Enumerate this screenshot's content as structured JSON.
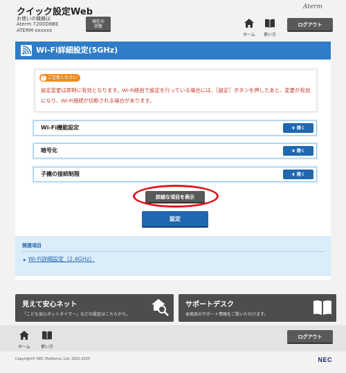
{
  "header": {
    "app_title": "クイック設定Web",
    "model_label": "お使いの機器は",
    "model_name": "Aterm 7200D8BE",
    "model_id": "ATERM-xxxxxx",
    "status_button": "現在の\n状態",
    "brand": "Aterm",
    "home_label": "ホーム",
    "manual_label": "使い方",
    "logout_label": "ログアウト"
  },
  "panel": {
    "title": "Wi-Fi詳細設定(5GHz)",
    "notice_badge": "ご注意ください",
    "notice_text": "設定変更は即時に有効となります。Wi-Fi経由で設定を行っている場合には、［設定］ボタンを押したあと、変更が有効になり、Wi-Fi接続が切断される場合があります。",
    "sections": [
      {
        "label": "Wi-Fi機能設定",
        "button": "開く"
      },
      {
        "label": "暗号化",
        "button": "開く"
      },
      {
        "label": "子機の接続制限",
        "button": "開く"
      }
    ],
    "detail_button": "詳細な項目を表示",
    "save_button": "設定"
  },
  "related": {
    "title": "関連項目",
    "link": "Wi-Fi詳細設定（2.4GHz）"
  },
  "banners": [
    {
      "title": "見えて安心ネット",
      "subtitle": "「こども安心ネットタイマー」などの設定はこちらから。"
    },
    {
      "title": "サポートデスク",
      "subtitle": "本商品のサポート情報をご覧いただけます。"
    }
  ],
  "footer": {
    "home_label": "ホーム",
    "manual_label": "使い方",
    "logout_label": "ログアウト",
    "copyright": "Copyright© NEC Platforms, Ltd. 2001-2025",
    "brand": "NEC"
  },
  "colors": {
    "accent_blue": "#2f7dc7",
    "button_blue": "#1f67b1",
    "notice_red": "#c0392b",
    "highlight_ring": "#e2141b",
    "badge_orange": "#f08c1e"
  }
}
